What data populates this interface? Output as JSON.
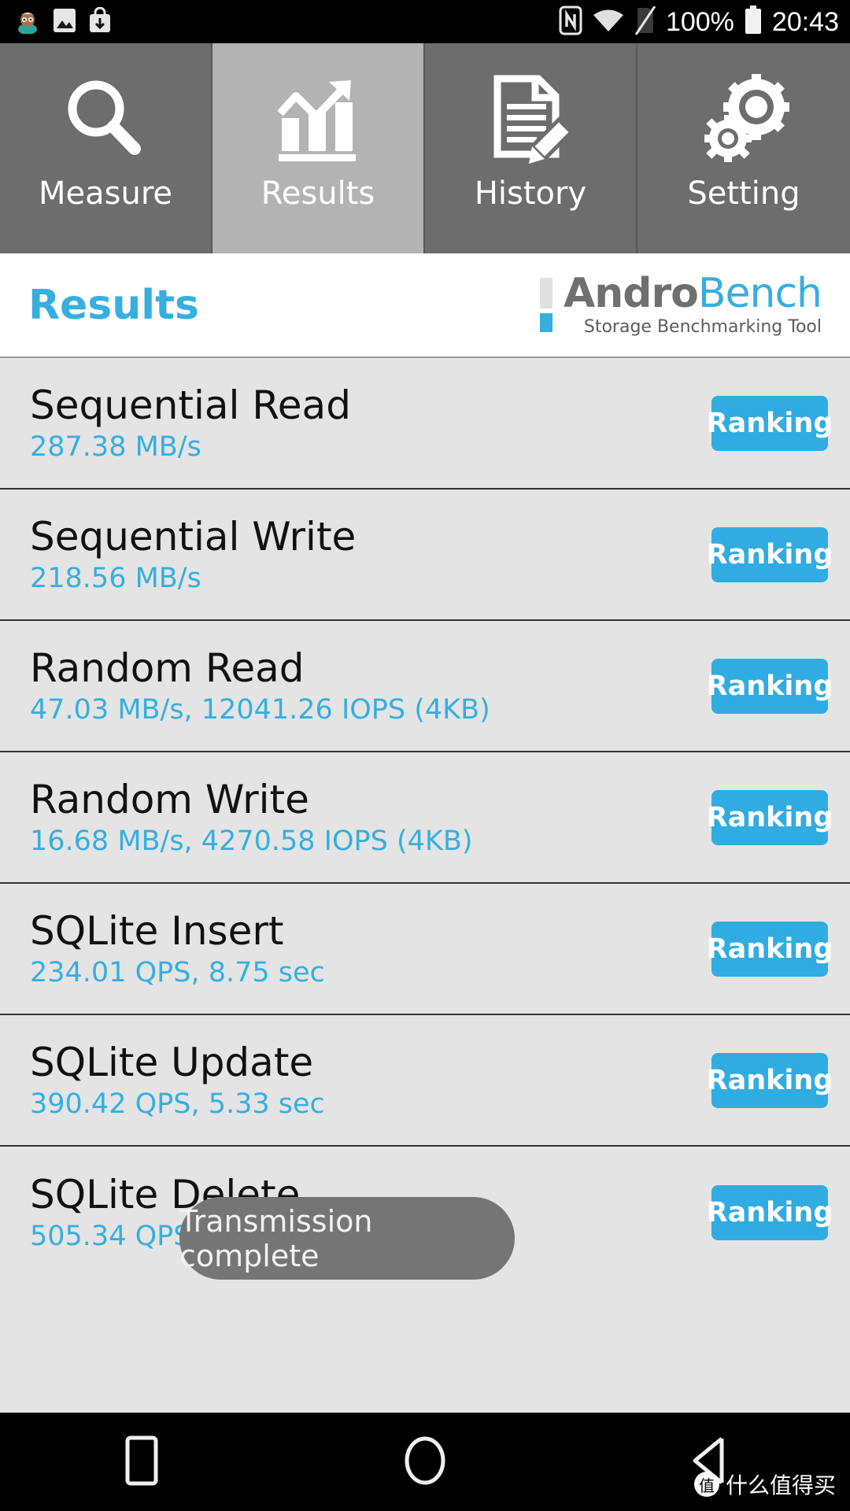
{
  "statusbar": {
    "icons_left": [
      "person-emoji-icon",
      "photo-icon",
      "download-bag-icon"
    ],
    "icons_right": [
      "nfc-icon",
      "wifi-icon",
      "sim-off-icon"
    ],
    "battery_percent": "100%",
    "battery_icon": "battery-full-icon",
    "time": "20:43"
  },
  "tabs": [
    {
      "label": "Measure",
      "icon": "magnifier-icon",
      "active": false
    },
    {
      "label": "Results",
      "icon": "bar-chart-arrow-icon",
      "active": true
    },
    {
      "label": "History",
      "icon": "document-pencil-icon",
      "active": false
    },
    {
      "label": "Setting",
      "icon": "gears-icon",
      "active": false
    }
  ],
  "header": {
    "title": "Results",
    "brand_part1": "Andro",
    "brand_part2": "Bench",
    "brand_subtitle": "Storage Benchmarking Tool"
  },
  "results": [
    {
      "title": "Sequential Read",
      "value": "287.38 MB/s",
      "button": "Ranking"
    },
    {
      "title": "Sequential Write",
      "value": "218.56 MB/s",
      "button": "Ranking"
    },
    {
      "title": "Random Read",
      "value": "47.03 MB/s, 12041.26 IOPS (4KB)",
      "button": "Ranking"
    },
    {
      "title": "Random Write",
      "value": "16.68 MB/s, 4270.58 IOPS (4KB)",
      "button": "Ranking"
    },
    {
      "title": "SQLite Insert",
      "value": "234.01 QPS, 8.75 sec",
      "button": "Ranking"
    },
    {
      "title": "SQLite Update",
      "value": "390.42 QPS, 5.33 sec",
      "button": "Ranking"
    },
    {
      "title": "SQLite Delete",
      "value": "505.34 QPS, 4.05 sec",
      "button": "Ranking"
    }
  ],
  "toast": {
    "message": "Transmission complete"
  },
  "navbar": {
    "recents_icon": "recents-square-icon",
    "home_icon": "home-circle-icon",
    "back_icon": "back-triangle-icon"
  },
  "watermark": {
    "badge": "值",
    "text": "什么值得买"
  },
  "colors": {
    "accent": "#36aee0",
    "button": "#31ace2",
    "tab_inactive": "#6d6d6d",
    "tab_active": "#b3b3b3",
    "list_bg": "#e4e4e4",
    "title_text": "#111111"
  }
}
